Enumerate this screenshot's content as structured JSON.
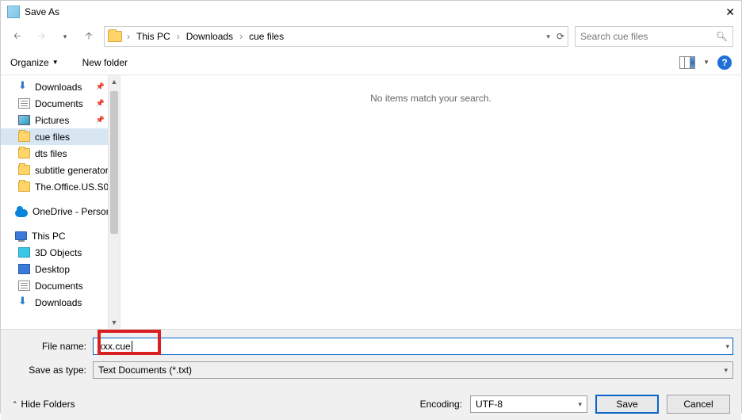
{
  "window": {
    "title": "Save As"
  },
  "breadcrumb": {
    "root": "This PC",
    "mid": "Downloads",
    "leaf": "cue files"
  },
  "search": {
    "placeholder": "Search cue files"
  },
  "toolbar": {
    "organize": "Organize",
    "newfolder": "New folder"
  },
  "tree": {
    "downloads": "Downloads",
    "documents": "Documents",
    "pictures": "Pictures",
    "cuefiles": "cue files",
    "dtsfiles": "dts files",
    "subtitle": "subtitle generator",
    "office": "The.Office.US.S0",
    "onedrive": "OneDrive - Person",
    "thispc": "This PC",
    "objects3d": "3D Objects",
    "desktop": "Desktop",
    "documents2": "Documents",
    "downloads2": "Downloads"
  },
  "content": {
    "empty": "No items match your search."
  },
  "fields": {
    "filename_label": "File name:",
    "filename_value": "xxx.cue",
    "type_label": "Save as type:",
    "type_value": "Text Documents (*.txt)"
  },
  "footer": {
    "hide": "Hide Folders",
    "encoding_label": "Encoding:",
    "encoding_value": "UTF-8",
    "save": "Save",
    "cancel": "Cancel"
  }
}
